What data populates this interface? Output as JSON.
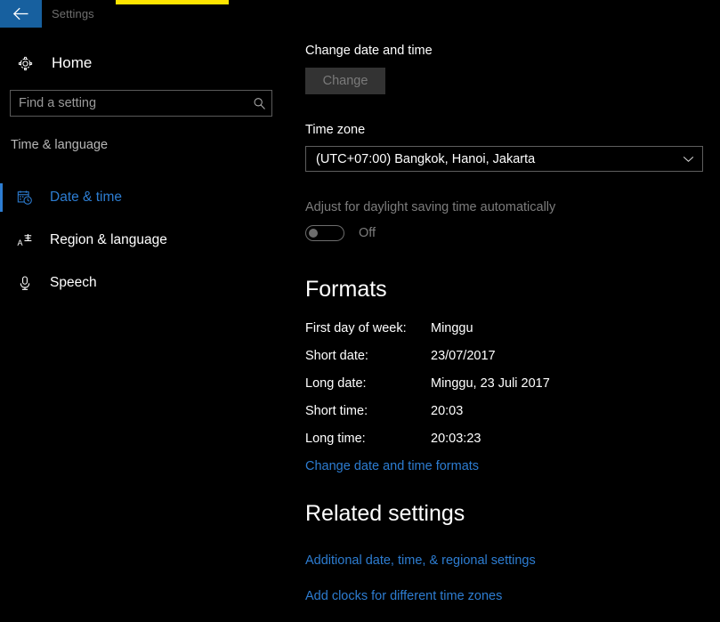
{
  "window": {
    "title": "Settings",
    "back_icon": "back-arrow-icon",
    "accent_color": "#ffe400",
    "back_button_color": "#17609f"
  },
  "sidebar": {
    "home": {
      "label": "Home",
      "icon": "gear-icon"
    },
    "search": {
      "placeholder": "Find a setting",
      "value": "",
      "icon": "search-icon"
    },
    "category": "Time & language",
    "items": [
      {
        "label": "Date & time",
        "icon": "calendar-clock-icon",
        "selected": true
      },
      {
        "label": "Region & language",
        "icon": "language-icon",
        "selected": false
      },
      {
        "label": "Speech",
        "icon": "microphone-icon",
        "selected": false
      }
    ],
    "selected_color": "#2d7dd2"
  },
  "main": {
    "change_date_time_label": "Change date and time",
    "change_button": {
      "label": "Change",
      "disabled": true
    },
    "time_zone": {
      "label": "Time zone",
      "value": "(UTC+07:00) Bangkok, Hanoi, Jakarta",
      "chevron_icon": "chevron-down-icon"
    },
    "daylight_saving": {
      "label": "Adjust for daylight saving time automatically",
      "state": "Off",
      "enabled": false
    },
    "formats": {
      "title": "Formats",
      "rows": [
        {
          "label": "First day of week:",
          "value": "Minggu"
        },
        {
          "label": "Short date:",
          "value": "23/07/2017"
        },
        {
          "label": "Long date:",
          "value": "Minggu, 23 Juli 2017"
        },
        {
          "label": "Short time:",
          "value": "20:03"
        },
        {
          "label": "Long time:",
          "value": "20:03:23"
        }
      ],
      "change_formats_link": "Change date and time formats"
    },
    "related_settings": {
      "title": "Related settings",
      "links": [
        "Additional date, time, & regional settings",
        "Add clocks for different time zones"
      ]
    },
    "link_color": "#2d7dd2"
  }
}
